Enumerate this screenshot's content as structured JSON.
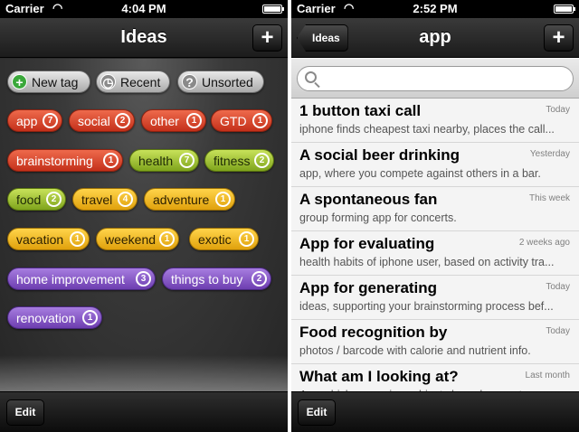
{
  "left": {
    "status": {
      "carrier": "Carrier",
      "time": "4:04 PM"
    },
    "nav": {
      "title": "Ideas",
      "add_label": "+"
    },
    "specials": [
      {
        "label": "New tag",
        "icon": "+"
      },
      {
        "label": "Recent",
        "icon": "◷"
      },
      {
        "label": "Unsorted",
        "icon": "?"
      }
    ],
    "tags": [
      {
        "label": "app",
        "count": "7",
        "color": "red"
      },
      {
        "label": "social",
        "count": "2",
        "color": "red"
      },
      {
        "label": "other",
        "count": "1",
        "color": "red"
      },
      {
        "label": "GTD",
        "count": "1",
        "color": "red"
      },
      {
        "label": "brainstorming",
        "count": "1",
        "color": "red"
      },
      {
        "label": "health",
        "count": "7",
        "color": "green"
      },
      {
        "label": "fitness",
        "count": "2",
        "color": "green"
      },
      {
        "label": "food",
        "count": "2",
        "color": "green"
      },
      {
        "label": "travel",
        "count": "4",
        "color": "orange"
      },
      {
        "label": "adventure",
        "count": "1",
        "color": "orange"
      },
      {
        "label": "vacation",
        "count": "1",
        "color": "orange"
      },
      {
        "label": "weekend",
        "count": "1",
        "color": "orange"
      },
      {
        "label": "exotic",
        "count": "1",
        "color": "orange"
      },
      {
        "label": "home improvement",
        "count": "3",
        "color": "purple"
      },
      {
        "label": "things to buy",
        "count": "2",
        "color": "purple"
      },
      {
        "label": "renovation",
        "count": "1",
        "color": "purple"
      }
    ],
    "toolbar": {
      "edit_label": "Edit"
    }
  },
  "right": {
    "status": {
      "carrier": "Carrier",
      "time": "2:52 PM"
    },
    "nav": {
      "back_label": "Ideas",
      "title": "app",
      "add_label": "+"
    },
    "search": {
      "placeholder": ""
    },
    "ideas": [
      {
        "title": "1 button taxi call",
        "date": "Today",
        "snippet": "iphone finds cheapest taxi nearby, places the call..."
      },
      {
        "title": "A social beer drinking",
        "date": "Yesterday",
        "snippet": "app, where you compete against others in a bar."
      },
      {
        "title": "A spontaneous fan",
        "date": "This week",
        "snippet": "group forming app for concerts."
      },
      {
        "title": "App for evaluating",
        "date": "2 weeks ago",
        "snippet": "health habits of iphone user, based on activity tra..."
      },
      {
        "title": "App for generating",
        "date": "Today",
        "snippet": "ideas, supporting your brainstorming process bef..."
      },
      {
        "title": "Food recognition by",
        "date": "Today",
        "snippet": "photos / barcode with calorie and nutrient info."
      },
      {
        "title": "What am I looking at?",
        "date": "Last month",
        "snippet": "App which recognizes objects based on vector..."
      }
    ],
    "toolbar": {
      "edit_label": "Edit"
    }
  },
  "colors": {
    "red": "#d9432a",
    "green": "#a5c93a",
    "orange": "#f2b824",
    "purple": "#8856c8"
  }
}
